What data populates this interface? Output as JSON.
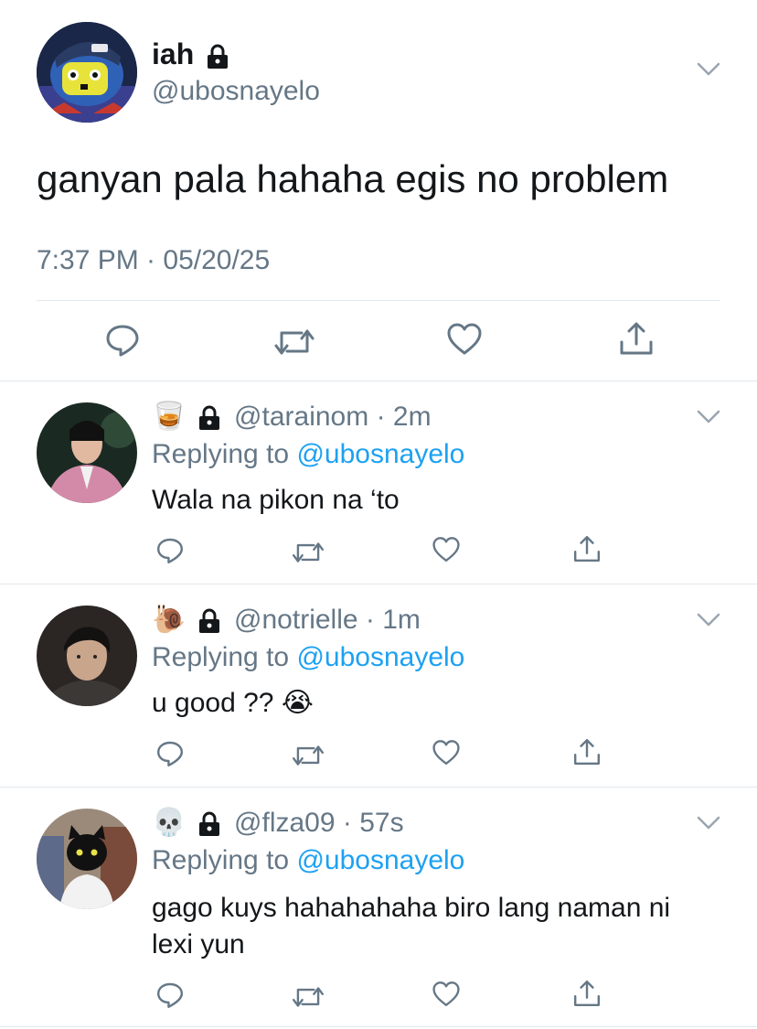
{
  "main_tweet": {
    "author_name": "iah",
    "author_handle": "@ubosnayelo",
    "text": "ganyan pala hahaha egis no problem",
    "timestamp": "7:37 PM · 05/20/25"
  },
  "replies": [
    {
      "emoji": "🥃",
      "handle": "@tarainom",
      "time": "2m",
      "replying_prefix": "Replying to",
      "replying_to": "@ubosnayelo",
      "text": "Wala na pikon na ‘to"
    },
    {
      "emoji": "🐌",
      "handle": "@notrielle",
      "time": "1m",
      "replying_prefix": "Replying to",
      "replying_to": "@ubosnayelo",
      "text": "u good ??",
      "text_emoji": "😭"
    },
    {
      "emoji": "💀",
      "handle": "@flza09",
      "time": "57s",
      "replying_prefix": "Replying to",
      "replying_to": "@ubosnayelo",
      "text_line1": "gago kuys hahahahaha biro lang naman ni",
      "text_line2": "lexi yun"
    }
  ],
  "icons": {
    "reply": "reply-icon",
    "retweet": "retweet-icon",
    "like": "heart-icon",
    "share": "share-icon",
    "more": "chevron-down-icon",
    "protected": "lock-icon"
  },
  "colors": {
    "text": "#14171a",
    "muted": "#657786",
    "link": "#1da1f2",
    "divider": "#e1e8ed"
  }
}
